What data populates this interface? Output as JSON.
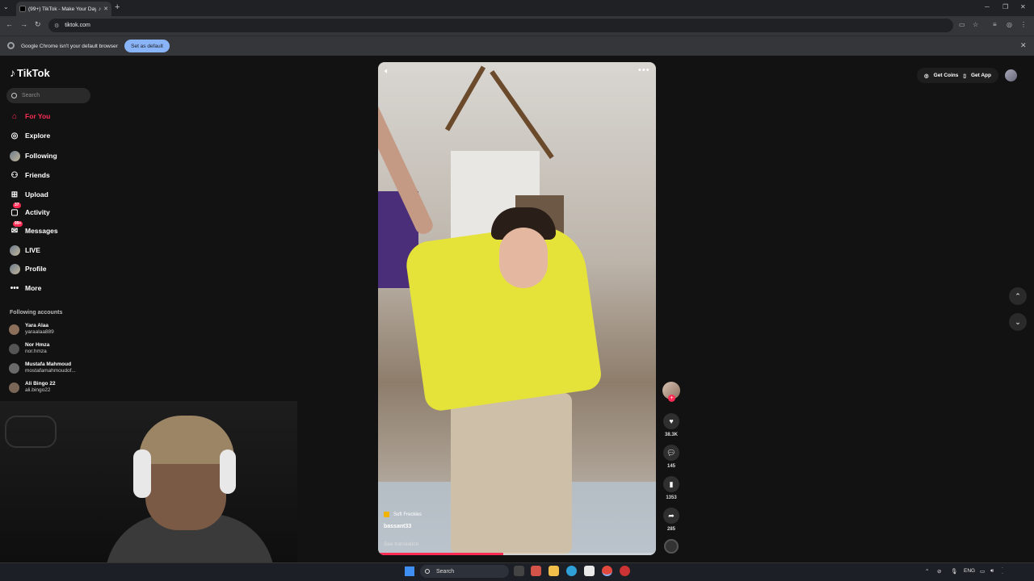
{
  "browser": {
    "tab_title": "(99+) TikTok - Make Your Day",
    "url": "tiktok.com",
    "infobar_message": "Google Chrome isn't your default browser",
    "set_default_label": "Set as default"
  },
  "sidebar": {
    "logo": "TikTok",
    "search_placeholder": "Search",
    "nav": [
      {
        "label": "For You",
        "badge": ""
      },
      {
        "label": "Explore",
        "badge": ""
      },
      {
        "label": "Following",
        "badge": ""
      },
      {
        "label": "Friends",
        "badge": ""
      },
      {
        "label": "Upload",
        "badge": ""
      },
      {
        "label": "Activity",
        "badge": "37"
      },
      {
        "label": "Messages",
        "badge": "99+"
      },
      {
        "label": "LIVE",
        "badge": ""
      },
      {
        "label": "Profile",
        "badge": ""
      },
      {
        "label": "More",
        "badge": ""
      }
    ],
    "following_title": "Following accounts",
    "accounts": [
      {
        "name": "Yara Alaa",
        "handle": "yaraalaa889"
      },
      {
        "name": "Nor Hmza",
        "handle": "nor.hmza"
      },
      {
        "name": "Mustafa Mahmoud",
        "handle": "mostafamahmoudof..."
      },
      {
        "name": "Ali Bingo 22",
        "handle": "ali.bingo22"
      }
    ]
  },
  "video": {
    "sound": "Soft Freckles",
    "author": "bassant33",
    "see_translation": "See translation",
    "progress": 0.45
  },
  "actions": {
    "likes": "38.3K",
    "comments": "145",
    "saves": "1353",
    "shares": "285"
  },
  "topbar": {
    "get_coins": "Get Coins",
    "get_app": "Get App"
  },
  "taskbar": {
    "search": "Search",
    "lang": "ENG"
  }
}
